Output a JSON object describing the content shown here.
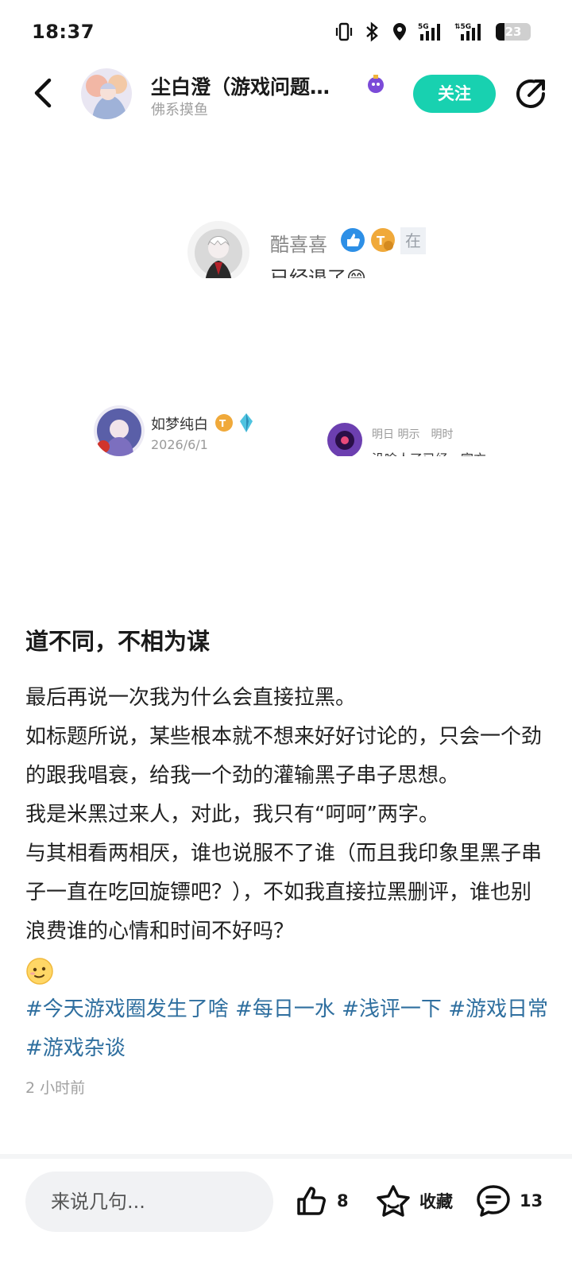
{
  "status_bar": {
    "time": "18:37",
    "battery": "23"
  },
  "header": {
    "author_name": "尘白澄（游戏问题…",
    "author_subtitle": "佛系摸鱼",
    "follow_label": "关注"
  },
  "images": {
    "snippet1": {
      "name": "酷喜喜",
      "tag": "在",
      "cut_text": "已经退了😄"
    },
    "snippet2": {
      "name": "如梦纯白",
      "date": "2026/6/1"
    },
    "snippet3": {
      "name": "明日 明示　明时",
      "cut_text": "没啥人了已经，官方"
    }
  },
  "post": {
    "title": "道不同，不相为谋",
    "paragraphs": [
      "最后再说一次我为什么会直接拉黑。",
      "如标题所说，某些根本就不想来好好讨论的，只会一个劲的跟我唱衰，给我一个劲的灌输黑子串子思想。",
      "我是米黑过来人，对此，我只有“呵呵”两字。",
      "与其相看两相厌，谁也说服不了谁（而且我印象里黑子串子一直在吃回旋镖吧？），不如我直接拉黑删评，谁也别浪费谁的心情和时间不好吗？"
    ],
    "tags": [
      "#今天游戏圈发生了啥",
      "#每日一水",
      "#浅评一下",
      "#游戏日常",
      "#游戏杂谈"
    ],
    "time_ago": "2 小时前"
  },
  "bottom_bar": {
    "comment_placeholder": "来说几句...",
    "like_count": "8",
    "favorite_label": "收藏",
    "comment_count": "13"
  },
  "colors": {
    "accent": "#18d1b0",
    "tag_link": "#2f6f9f",
    "subtle_text": "#a0a0a0"
  },
  "icons": [
    "back-arrow-icon",
    "share-icon",
    "like-icon",
    "star-icon",
    "comment-icon"
  ]
}
